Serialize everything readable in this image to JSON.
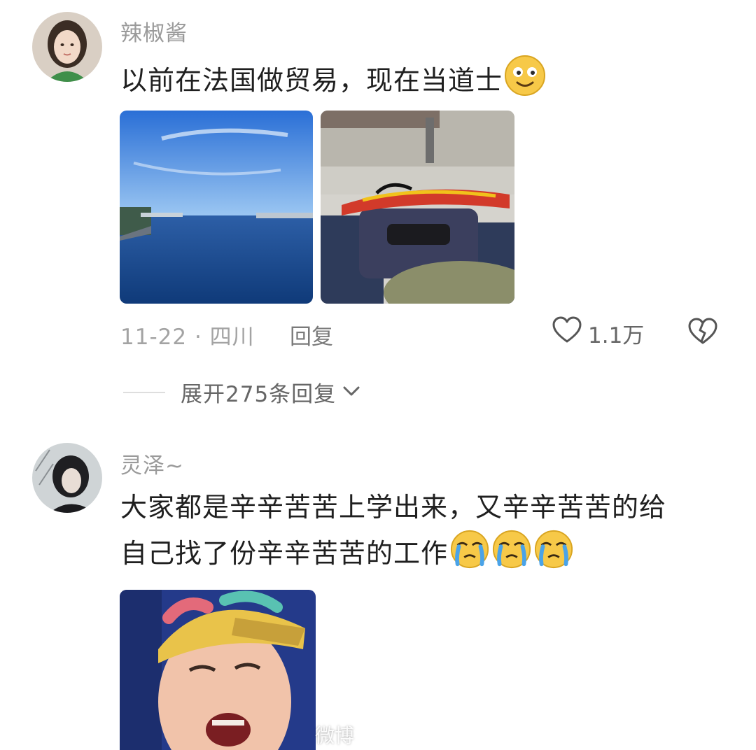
{
  "comments": [
    {
      "username": "辣椒酱",
      "text": "以前在法国做贸易，现在当道士",
      "emoji": "smile-emoji",
      "date": "11-22",
      "location": "四川",
      "reply_label": "回复",
      "likes": "1.1万",
      "expand_label": "展开275条回复"
    },
    {
      "username": "灵泽~",
      "line1": "大家都是辛辛苦苦上学出来，又辛辛苦苦的给",
      "line2": "自己找了份辛辛苦苦的工作",
      "emoji": "crying-emoji"
    }
  ],
  "watermark": "微博"
}
